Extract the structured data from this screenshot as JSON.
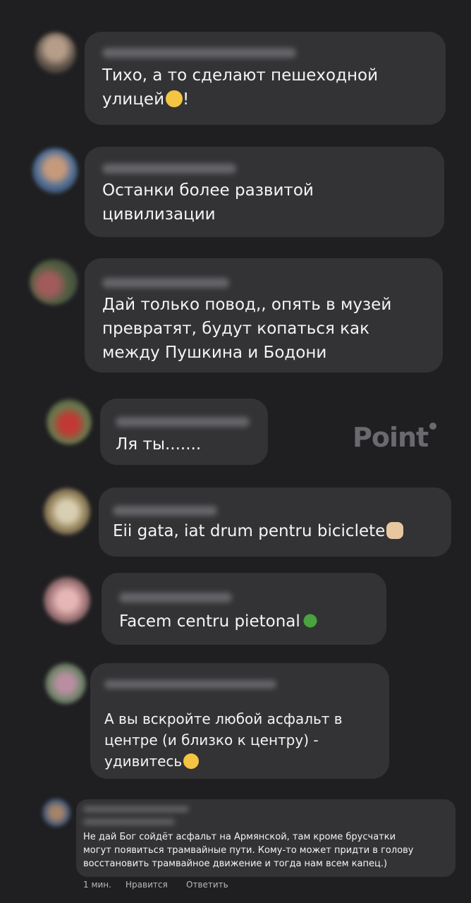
{
  "comments": [
    {
      "text": "Тихо, а то сделают пешеходной\nулицей",
      "suffix": "!",
      "emoji": "shushing-face-icon"
    },
    {
      "text": "Останки более развитой\nцивилизации"
    },
    {
      "text": "Дай только повод,, опять в музей\nпревратят, будут копаться как\nмежду Пушкина и Бодони"
    },
    {
      "text": "Ля ты......."
    },
    {
      "text": "Eii gata, iat drum pentru biciclete",
      "emoji": "facepalm-icon"
    },
    {
      "text": "Facem centru pietonal",
      "emoji": "clover-icon"
    },
    {
      "text": "А вы вскройте любой асфальт в\nцентре (и близко к центру) -\nудивитесь",
      "emoji": "smirk-face-icon"
    },
    {
      "text": "Не дай Бог сойдёт асфальт на Армянской, там кроме брусчатки\nмогут появиться трамвайные пути. Кому-то может придти в голову\nвосстановить трамвайное движение и тогда нам всем капец.)"
    }
  ],
  "watermark": "Point",
  "footer": {
    "time": "1 мин.",
    "like": "Нравится",
    "reply": "Ответить"
  }
}
